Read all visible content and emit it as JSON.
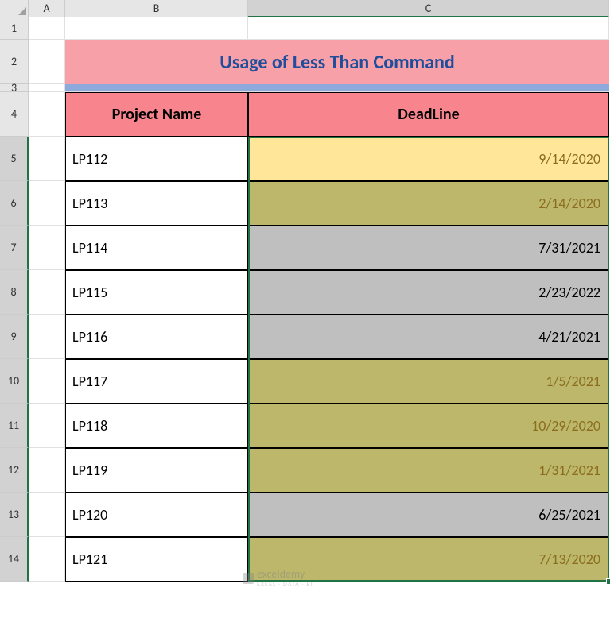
{
  "columns": {
    "A": "A",
    "B": "B",
    "C": "C"
  },
  "rows": [
    "1",
    "2",
    "3",
    "4",
    "5",
    "6",
    "7",
    "8",
    "9",
    "10",
    "11",
    "12",
    "13",
    "14"
  ],
  "title": "Usage of Less Than Command",
  "headers": {
    "project": "Project Name",
    "deadline": "DeadLine"
  },
  "data": [
    {
      "name": "LP112",
      "date": "9/14/2020",
      "cls": "sel-first"
    },
    {
      "name": "LP113",
      "date": "2/14/2020",
      "cls": "sel-olive"
    },
    {
      "name": "LP114",
      "date": "7/31/2021",
      "cls": "sel-gray"
    },
    {
      "name": "LP115",
      "date": "2/23/2022",
      "cls": "sel-gray"
    },
    {
      "name": "LP116",
      "date": "4/21/2021",
      "cls": "sel-gray"
    },
    {
      "name": "LP117",
      "date": "1/5/2021",
      "cls": "sel-olive"
    },
    {
      "name": "LP118",
      "date": "10/29/2020",
      "cls": "sel-olive"
    },
    {
      "name": "LP119",
      "date": "1/31/2021",
      "cls": "sel-olive"
    },
    {
      "name": "LP120",
      "date": "6/25/2021",
      "cls": "sel-gray"
    },
    {
      "name": "LP121",
      "date": "7/13/2020",
      "cls": "sel-olive"
    }
  ],
  "watermark": {
    "main": "exceldemy",
    "sub": "EXCEL · DATA · BI"
  },
  "chart_data": {
    "type": "table",
    "title": "Usage of Less Than Command",
    "columns": [
      "Project Name",
      "DeadLine"
    ],
    "rows": [
      [
        "LP112",
        "9/14/2020"
      ],
      [
        "LP113",
        "2/14/2020"
      ],
      [
        "LP114",
        "7/31/2021"
      ],
      [
        "LP115",
        "2/23/2022"
      ],
      [
        "LP116",
        "4/21/2021"
      ],
      [
        "LP117",
        "1/5/2021"
      ],
      [
        "LP118",
        "10/29/2020"
      ],
      [
        "LP119",
        "1/31/2021"
      ],
      [
        "LP120",
        "6/25/2021"
      ],
      [
        "LP121",
        "7/13/2020"
      ]
    ]
  }
}
